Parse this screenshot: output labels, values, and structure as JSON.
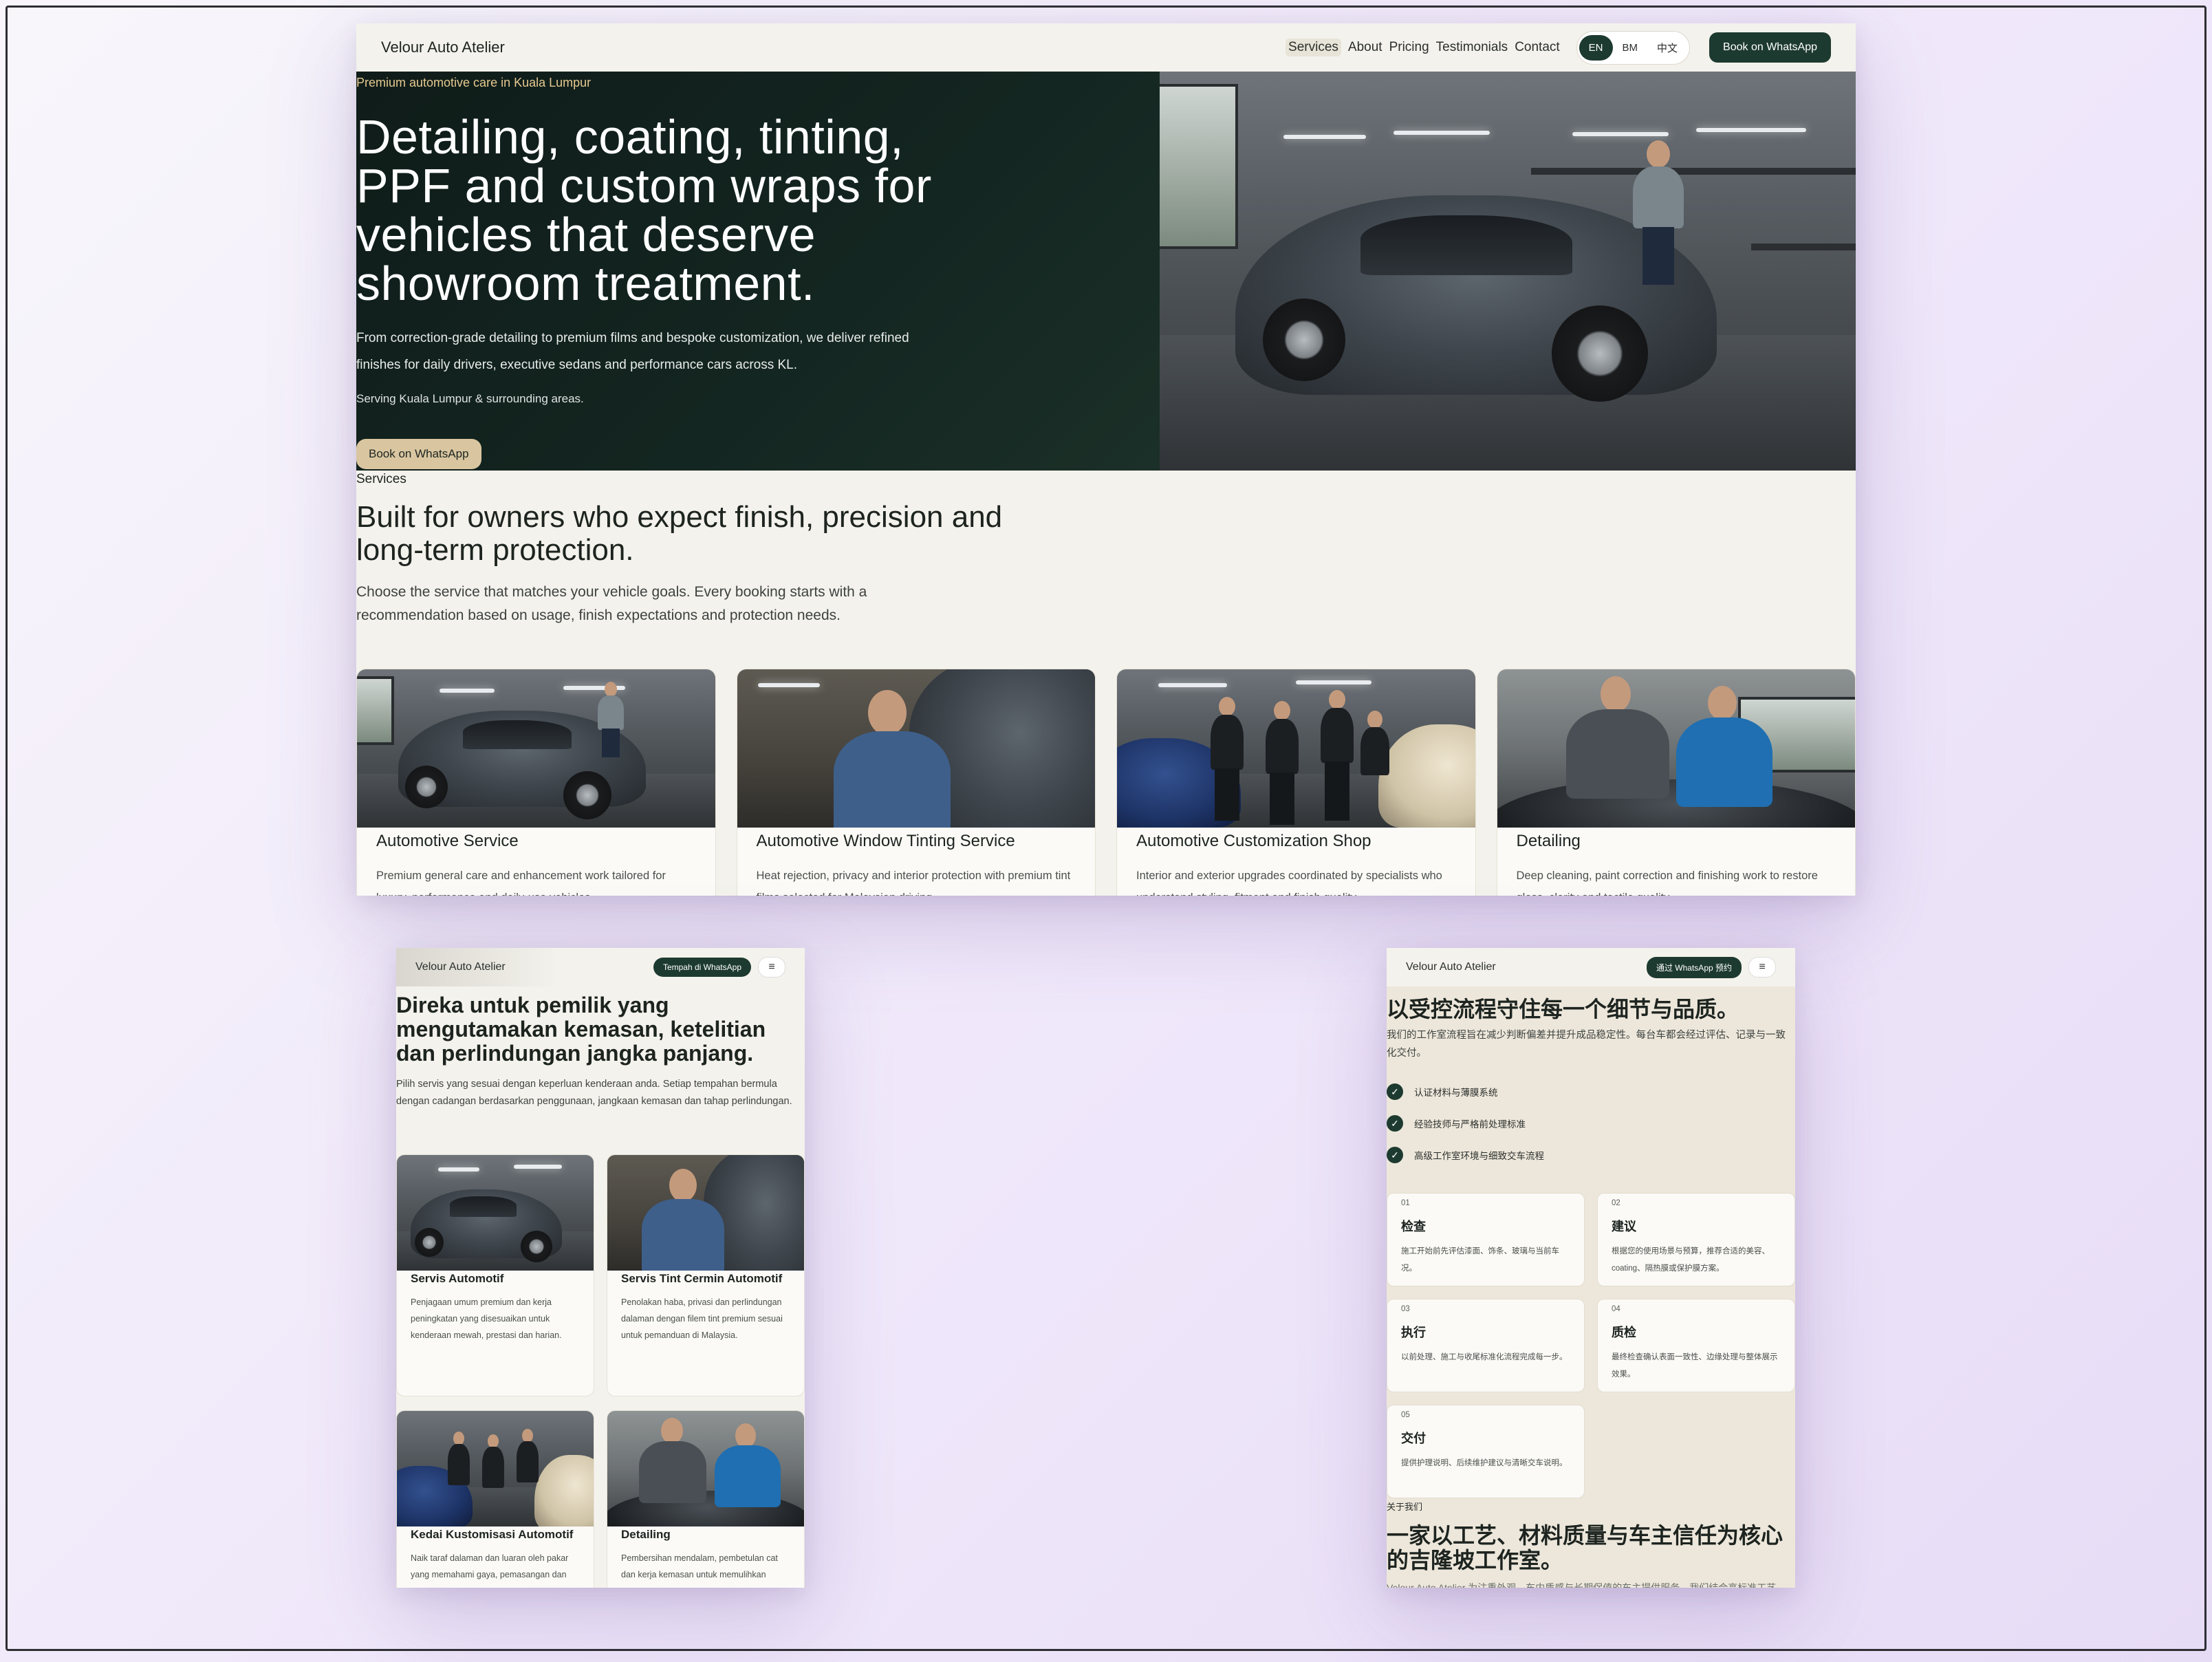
{
  "desktop": {
    "brand": "Velour Auto Atelier",
    "nav": [
      "Services",
      "About",
      "Pricing",
      "Testimonials",
      "Contact"
    ],
    "lang": [
      "EN",
      "BM",
      "中文"
    ],
    "book_top": "Book on WhatsApp",
    "hero": {
      "eyebrow": "Premium automotive care in Kuala Lumpur",
      "title": "Detailing, coating, tinting, PPF and custom wraps for vehicles that deserve showroom treatment.",
      "body": "From correction-grade detailing to premium films and bespoke customization, we deliver refined finishes for daily drivers, executive sedans and performance cars across KL.",
      "serving": "Serving Kuala Lumpur & surrounding areas.",
      "button": "Book on WhatsApp"
    },
    "services": {
      "eyebrow": "Services",
      "title": "Built for owners who expect finish, precision and long-term protection.",
      "body": "Choose the service that matches your vehicle goals. Every booking starts with a recommendation based on usage, finish expectations and protection needs.",
      "cards": [
        {
          "title": "Automotive Service",
          "desc": "Premium general care and enhancement work tailored for luxury, performance and daily-use vehicles."
        },
        {
          "title": "Automotive Window Tinting Service",
          "desc": "Heat rejection, privacy and interior protection with premium tint films selected for Malaysian driving."
        },
        {
          "title": "Automotive Customization Shop",
          "desc": "Interior and exterior upgrades coordinated by specialists who understand styling, fitment and finish quality."
        },
        {
          "title": "Detailing",
          "desc": "Deep cleaning, paint correction and finishing work to restore gloss, clarity and tactile quality."
        }
      ]
    }
  },
  "mobile_bm": {
    "brand": "Velour Auto Atelier",
    "button": "Tempah di WhatsApp",
    "menu_icon": "≡",
    "title": "Direka untuk pemilik yang mengutamakan kemasan, ketelitian dan perlindungan jangka panjang.",
    "body": "Pilih servis yang sesuai dengan keperluan kenderaan anda. Setiap tempahan bermula dengan cadangan berdasarkan penggunaan, jangkaan kemasan dan tahap perlindungan.",
    "cards": [
      {
        "title": "Servis Automotif",
        "desc": "Penjagaan umum premium dan kerja peningkatan yang disesuaikan untuk kenderaan mewah, prestasi dan harian."
      },
      {
        "title": "Servis Tint Cermin Automotif",
        "desc": "Penolakan haba, privasi dan perlindungan dalaman dengan filem tint premium sesuai untuk pemanduan di Malaysia."
      },
      {
        "title": "Kedai Kustomisasi Automotif",
        "desc": "Naik taraf dalaman dan luaran oleh pakar yang memahami gaya, pemasangan dan"
      },
      {
        "title": "Detailing",
        "desc": "Pembersihan mendalam, pembetulan cat dan kerja kemasan untuk memulihkan"
      }
    ]
  },
  "mobile_zh": {
    "brand": "Velour Auto Atelier",
    "button": "通过 WhatsApp 预约",
    "menu_icon": "≡",
    "title": "以受控流程守住每一个细节与品质。",
    "body": "我们的工作室流程旨在减少判断偏差并提升成品稳定性。每台车都会经过评估、记录与一致化交付。",
    "checks": [
      "认证材料与薄膜系统",
      "经验技师与严格前处理标准",
      "高级工作室环境与细致交车流程"
    ],
    "steps": [
      {
        "n": "01",
        "t": "检查",
        "d": "施工开始前先评估漆面、饰条、玻璃与当前车况。"
      },
      {
        "n": "02",
        "t": "建议",
        "d": "根据您的使用场景与预算，推荐合适的美容、coating、隔热膜或保护膜方案。"
      },
      {
        "n": "03",
        "t": "执行",
        "d": "以前处理、施工与收尾标准化流程完成每一步。"
      },
      {
        "n": "04",
        "t": "质检",
        "d": "最终检查确认表面一致性、边缘处理与整体展示效果。"
      },
      {
        "n": "05",
        "t": "交付",
        "d": "提供护理说明、后续维护建议与清晰交车说明。"
      }
    ],
    "about_eyebrow": "关于我们",
    "about_title": "一家以工艺、材料质量与车主信任为核心的吉隆坡工作室。",
    "about_cut": "Velour Auto Atelier 为注重外观、车内质感与长期保值的车主提供服务，我们结合高标准工艺。"
  }
}
